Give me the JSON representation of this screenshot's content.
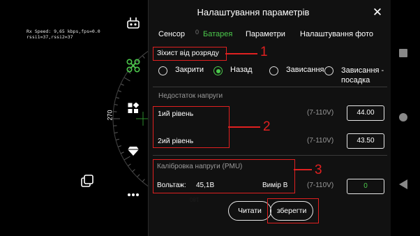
{
  "telemetry": {
    "line1": "Rx Speed: 9,65 kbps,fps=0.0",
    "line2": "rssi1=37,rssi2=37"
  },
  "compass": {
    "heading": "270",
    "bottom_mark": "180"
  },
  "panel": {
    "title": "Налаштування параметрів",
    "close_label": "✕",
    "tabs": [
      {
        "label": "Сенсор",
        "active": false
      },
      {
        "label": "Батарея",
        "active": true
      },
      {
        "label": "Параметри",
        "active": false
      },
      {
        "label": "Налаштування фото",
        "active": false
      }
    ],
    "tab_dot": "0",
    "discharge": {
      "label": "Зіхист від розряду",
      "options": [
        {
          "label": "Закрити",
          "selected": false
        },
        {
          "label": "Назад",
          "selected": true
        },
        {
          "label": "Зависання",
          "selected": false
        },
        {
          "label": "Зависання - посадка",
          "selected": false
        }
      ]
    },
    "low_voltage": {
      "label": "Недостаток напруги",
      "level1_label": "1ий рівень",
      "level1_range": "(7-110V)",
      "level1_value": "44.00",
      "level2_label": "2ий рівень",
      "level2_range": "(7-110V)",
      "level2_value": "43.50"
    },
    "calibration": {
      "label": "Калібровка напруги (PMU)",
      "voltage_label": "Вольтаж:",
      "voltage_value": "45,1В",
      "measure_label": "Вимір В",
      "range": "(7-110V)",
      "measure_value": "0"
    },
    "buttons": {
      "read": "Читати",
      "save": "зберегти"
    }
  },
  "annotations": {
    "n1": "1",
    "n2": "2",
    "n3": "3"
  },
  "colors": {
    "accent": "#4cc94c",
    "annotation": "#e02020",
    "panel_bg": "#121212"
  },
  "icons": {
    "side": [
      "remote-controller-icon",
      "drone-icon",
      "apps-icon",
      "diamond-icon",
      "layers-icon",
      "more-icon"
    ],
    "system": [
      "square-icon",
      "circle-icon",
      "back-icon"
    ]
  }
}
